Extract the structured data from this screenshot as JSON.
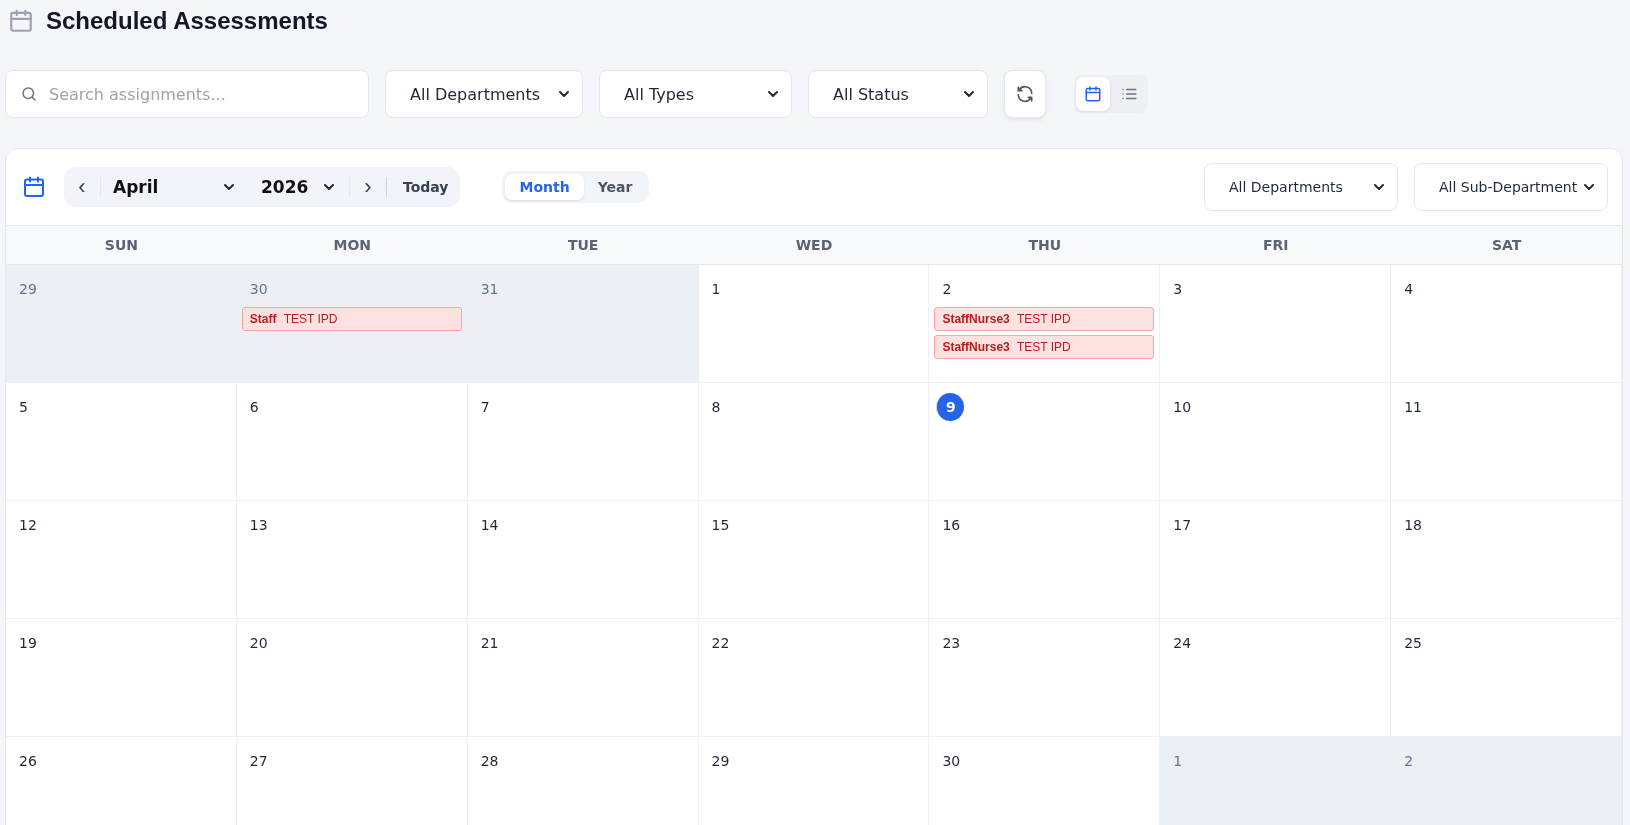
{
  "title": "Scheduled Assessments",
  "filters": {
    "search": {
      "placeholder": "Search assignments..."
    },
    "selects": [
      "All Departments",
      "All Types",
      "All Status"
    ]
  },
  "view_toggle": [
    {
      "kind": "calendar",
      "selected": true
    },
    {
      "kind": "list",
      "selected": false
    }
  ],
  "calendar": {
    "month": "April",
    "year": "2026",
    "prev": "‹",
    "next": "›",
    "today": "Today",
    "modes": [
      {
        "label": "Month",
        "selected": true
      },
      {
        "label": "Year",
        "selected": false
      }
    ],
    "selects": [
      "All Departments",
      "All Sub-Department"
    ],
    "weekdays": [
      "SUN",
      "MON",
      "TUE",
      "WED",
      "THU",
      "FRI",
      "SAT"
    ],
    "weeks": [
      [
        {
          "day": "29",
          "outside": true,
          "today": false
        },
        {
          "day": "30",
          "outside": true,
          "today": false,
          "events": [
            {
              "who": "Staff",
              "what": "TEST IPD"
            }
          ]
        },
        {
          "day": "31",
          "outside": true,
          "today": false
        },
        {
          "day": "1",
          "outside": false,
          "today": false
        },
        {
          "day": "2",
          "outside": false,
          "today": false,
          "events": [
            {
              "who": "StaffNurse3",
              "what": "TEST IPD"
            },
            {
              "who": "StaffNurse3",
              "what": "TEST IPD"
            }
          ]
        },
        {
          "day": "3",
          "outside": false,
          "today": false
        },
        {
          "day": "4",
          "outside": false,
          "today": false
        }
      ],
      [
        {
          "day": "5",
          "outside": false,
          "today": false
        },
        {
          "day": "6",
          "outside": false,
          "today": false
        },
        {
          "day": "7",
          "outside": false,
          "today": false
        },
        {
          "day": "8",
          "outside": false,
          "today": false
        },
        {
          "day": "9",
          "outside": false,
          "today": true
        },
        {
          "day": "10",
          "outside": false,
          "today": false
        },
        {
          "day": "11",
          "outside": false,
          "today": false
        }
      ],
      [
        {
          "day": "12",
          "outside": false,
          "today": false
        },
        {
          "day": "13",
          "outside": false,
          "today": false
        },
        {
          "day": "14",
          "outside": false,
          "today": false
        },
        {
          "day": "15",
          "outside": false,
          "today": false
        },
        {
          "day": "16",
          "outside": false,
          "today": false
        },
        {
          "day": "17",
          "outside": false,
          "today": false
        },
        {
          "day": "18",
          "outside": false,
          "today": false
        }
      ],
      [
        {
          "day": "19",
          "outside": false,
          "today": false
        },
        {
          "day": "20",
          "outside": false,
          "today": false
        },
        {
          "day": "21",
          "outside": false,
          "today": false
        },
        {
          "day": "22",
          "outside": false,
          "today": false
        },
        {
          "day": "23",
          "outside": false,
          "today": false
        },
        {
          "day": "24",
          "outside": false,
          "today": false
        },
        {
          "day": "25",
          "outside": false,
          "today": false
        }
      ],
      [
        {
          "day": "26",
          "outside": false,
          "today": false
        },
        {
          "day": "27",
          "outside": false,
          "today": false
        },
        {
          "day": "28",
          "outside": false,
          "today": false
        },
        {
          "day": "29",
          "outside": false,
          "today": false
        },
        {
          "day": "30",
          "outside": false,
          "today": false
        },
        {
          "day": "1",
          "outside": true,
          "today": false
        },
        {
          "day": "2",
          "outside": true,
          "today": false
        }
      ]
    ]
  }
}
